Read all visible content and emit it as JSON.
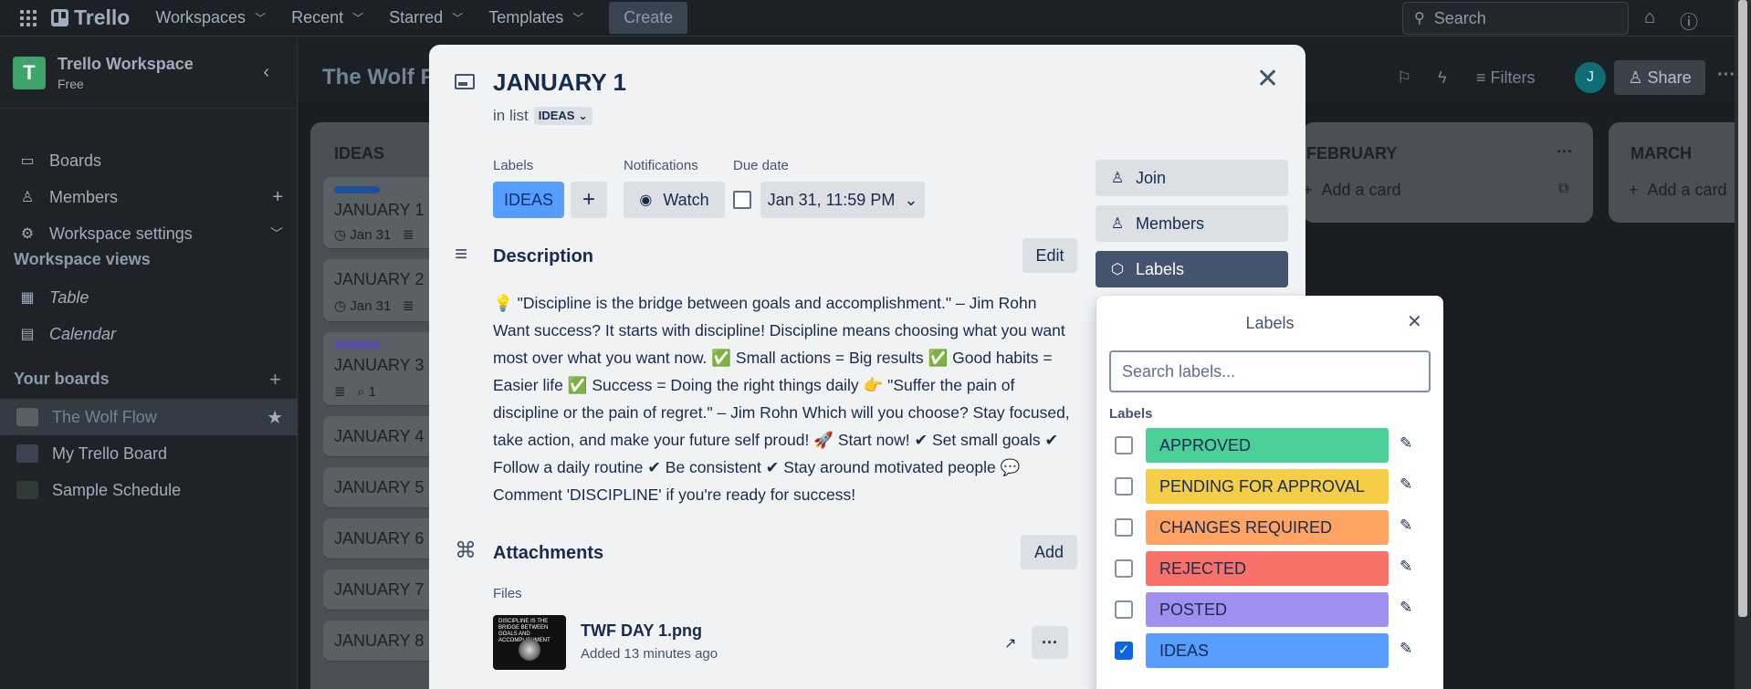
{
  "topnav": {
    "logo": "Trello",
    "menu": [
      {
        "label": "Workspaces"
      },
      {
        "label": "Recent"
      },
      {
        "label": "Starred"
      },
      {
        "label": "Templates"
      }
    ],
    "create": "Create",
    "search_placeholder": "Search"
  },
  "sidebar": {
    "workspace_initial": "T",
    "workspace_name": "Trello Workspace",
    "workspace_plan": "Free",
    "items": [
      {
        "label": "Boards"
      },
      {
        "label": "Members"
      },
      {
        "label": "Workspace settings"
      }
    ],
    "views_heading": "Workspace views",
    "views": [
      {
        "label": "Table"
      },
      {
        "label": "Calendar"
      }
    ],
    "boards_heading": "Your boards",
    "boards": [
      {
        "label": "The Wolf Flow",
        "color": "#5b5f66"
      },
      {
        "label": "My Trello Board",
        "color": "#3b4252"
      },
      {
        "label": "Sample Schedule",
        "color": "#2f3a36"
      }
    ]
  },
  "board": {
    "title": "The Wolf Fl",
    "filters": "Filters",
    "share": "Share",
    "member_initial": "J",
    "ideas_list": {
      "title": "IDEAS",
      "cards": [
        {
          "title": "JANUARY 1",
          "meta": "Jan 31",
          "label_color": "#1f4e99"
        },
        {
          "title": "JANUARY 2",
          "meta": "Jan 31"
        },
        {
          "title": "JANUARY 3",
          "meta": "1",
          "label_color": "#5a4fa8"
        },
        {
          "title": "JANUARY 4"
        },
        {
          "title": "JANUARY 5"
        },
        {
          "title": "JANUARY 6"
        },
        {
          "title": "JANUARY 7"
        },
        {
          "title": "JANUARY 8"
        }
      ]
    },
    "february": {
      "title": "FEBRUARY",
      "add": "Add a card"
    },
    "march": {
      "title": "MARCH",
      "add": "Add a card"
    }
  },
  "modal": {
    "title": "JANUARY 1",
    "in_list_prefix": "in list",
    "in_list": "IDEAS",
    "labels_heading": "Labels",
    "label_chip": "IDEAS",
    "notifications_heading": "Notifications",
    "watch": "Watch",
    "due_heading": "Due date",
    "due_value": "Jan 31, 11:59 PM",
    "description_title": "Description",
    "edit": "Edit",
    "description": "💡 \"Discipline is the bridge between goals and accomplishment.\" – Jim Rohn Want success? It starts with discipline! Discipline means choosing what you want most over what you want now. ✅ Small actions = Big results ✅ Good habits = Easier life ✅ Success = Doing the right things daily 👉 \"Suffer the pain of discipline or the pain of regret.\" – Jim Rohn Which will you choose? Stay focused, take action, and make your future self proud! 🚀 Start now! ✔ Set small goals ✔ Follow a daily routine ✔ Be consistent ✔ Stay around motivated people 💬 Comment 'DISCIPLINE' if you're ready for success!",
    "attachments_title": "Attachments",
    "add": "Add",
    "files_heading": "Files",
    "file_name": "TWF DAY 1.png",
    "file_added": "Added 13 minutes ago",
    "thumb_text": "DISCIPLINE IS THE BRIDGE BETWEEN GOALS AND ACCOMPLISHMENT",
    "side_buttons": [
      {
        "label": "Join",
        "icon": "person-add-icon"
      },
      {
        "label": "Members",
        "icon": "person-icon"
      },
      {
        "label": "Labels",
        "icon": "tag-icon"
      }
    ]
  },
  "labels_popover": {
    "title": "Labels",
    "search_placeholder": "Search labels...",
    "subheading": "Labels",
    "labels": [
      {
        "name": "APPROVED",
        "color": "#4bce97",
        "checked": false
      },
      {
        "name": "PENDING FOR APPROVAL",
        "color": "#f5cd47",
        "checked": false
      },
      {
        "name": "CHANGES REQUIRED",
        "color": "#fea362",
        "checked": false
      },
      {
        "name": "REJECTED",
        "color": "#f87168",
        "checked": false
      },
      {
        "name": "POSTED",
        "color": "#9f8fef",
        "checked": false
      },
      {
        "name": "IDEAS",
        "color": "#579dff",
        "checked": true
      }
    ]
  }
}
